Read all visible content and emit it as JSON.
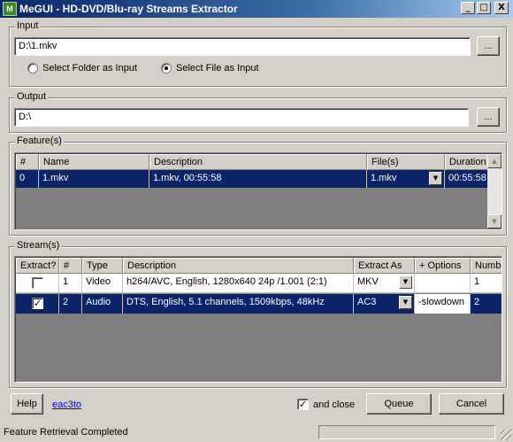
{
  "window": {
    "title": "MeGUI - HD-DVD/Blu-ray Streams Extractor",
    "app_icon_text": "M",
    "minimize_glyph": "_",
    "maximize_glyph": "□",
    "close_glyph": "X"
  },
  "input": {
    "group_label": "Input",
    "path_value": "D:\\1.mkv",
    "browse_label": "...",
    "radio_folder_label": "Select Folder as Input",
    "radio_file_label": "Select File as Input",
    "selected_mode": "file"
  },
  "output": {
    "group_label": "Output",
    "path_value": "D:\\",
    "browse_label": "..."
  },
  "features": {
    "group_label": "Feature(s)",
    "columns": [
      "#",
      "Name",
      "Description",
      "File(s)",
      "Duration"
    ],
    "rows": [
      {
        "num": "0",
        "name": "1.mkv",
        "description": "1.mkv, 00:55:58",
        "files": "1.mkv",
        "duration": "00:55:58",
        "selected": true
      }
    ],
    "scroll_up_glyph": "▲",
    "scroll_down_glyph": "▼"
  },
  "streams": {
    "group_label": "Stream(s)",
    "columns": [
      "Extract?",
      "#",
      "Type",
      "Description",
      "Extract As",
      "+ Options",
      "Numbe"
    ],
    "rows": [
      {
        "extract": false,
        "num": "1",
        "type": "Video",
        "description": "h264/AVC, English, 1280x640 24p /1.001 (2:1)",
        "extract_as": "MKV",
        "options": "",
        "number": "1",
        "selected": false
      },
      {
        "extract": true,
        "num": "2",
        "type": "Audio",
        "description": "DTS, English, 5.1 channels, 1509kbps, 48kHz",
        "extract_as": "AC3",
        "options": "-slowdown",
        "number": "2",
        "selected": true
      }
    ],
    "check_glyph": "✓",
    "combo_arrow_glyph": "▼"
  },
  "footer": {
    "help_label": "Help",
    "link_label": "eac3to",
    "and_close_label": "and close",
    "and_close_checked": true,
    "queue_label": "Queue",
    "cancel_label": "Cancel"
  },
  "status": {
    "text": "Feature Retrieval Completed",
    "progress": 0
  },
  "colors": {
    "selection": "#0a246a",
    "face": "#d4d0c8",
    "list_background": "#808080",
    "link": "#0000ff"
  }
}
